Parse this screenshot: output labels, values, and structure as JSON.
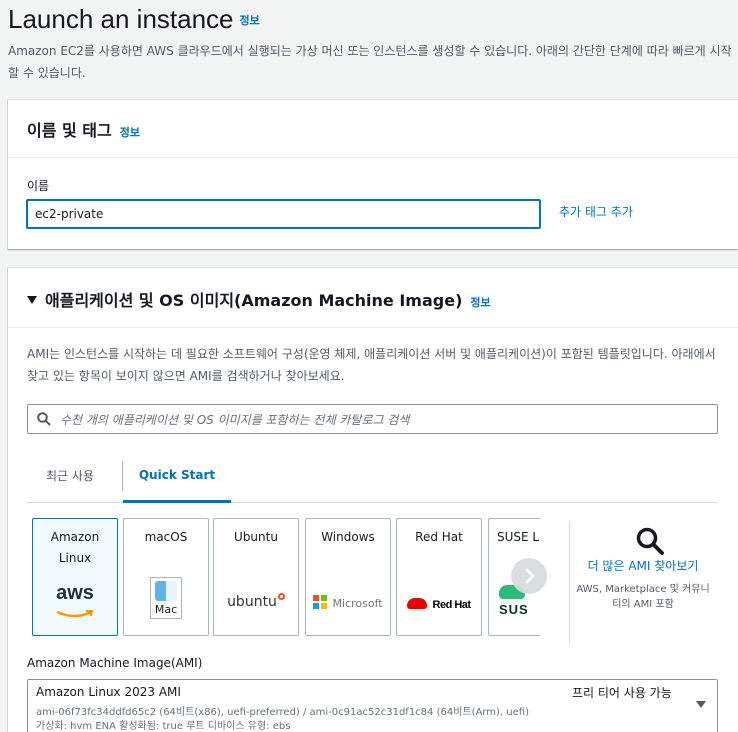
{
  "page": {
    "title": "Launch an instance",
    "info": "정보",
    "description": "Amazon EC2를 사용하면 AWS 클라우드에서 실행되는 가상 머신 또는 인스턴스를 생성할 수 있습니다. 아래의 간단한 단계에 따라 빠르게 시작할 수 있습니다."
  },
  "name_section": {
    "title": "이름 및 태그",
    "info": "정보",
    "name_label": "이름",
    "name_value": "ec2-private",
    "add_tag": "추가 태그 추가"
  },
  "ami_section": {
    "title": "애플리케이션 및 OS 이미지(Amazon Machine Image)",
    "info": "정보",
    "description": "AMI는 인스턴스를 시작하는 데 필요한 소프트웨어 구성(운영 체제, 애플리케이션 서버 및 애플리케이션)이 포함된 템플릿입니다. 아래에서 찾고 있는 항목이 보이지 않으면 AMI를 검색하거나 찾아보세요.",
    "search_placeholder": "수천 개의 애플리케이션 및 OS 이미지를 포함하는 전체 카탈로그 검색",
    "tabs": [
      "최근 사용",
      "Quick Start"
    ],
    "active_tab": "Quick Start",
    "cards": [
      {
        "label": "Amazon Linux",
        "logo": "aws",
        "selected": true
      },
      {
        "label": "macOS",
        "logo": "Mac"
      },
      {
        "label": "Ubuntu",
        "logo": "ubuntu"
      },
      {
        "label": "Windows",
        "logo": "Microsoft"
      },
      {
        "label": "Red Hat",
        "logo": "Red Hat"
      },
      {
        "label": "SUSE Li",
        "logo": "SUS"
      }
    ],
    "more_link": "더 많은 AMI 찾아보기",
    "more_sub": "AWS, Marketplace 및 커뮤니티의 AMI 포함",
    "ami_label": "Amazon Machine Image(AMI)",
    "ami_name": "Amazon Linux 2023 AMI",
    "ami_id": "ami-06f73fc34ddfd65c2 (64비트(x86), uefi-preferred) / ami-0c91ac52c31df1c84 (64비트(Arm), uefi)",
    "ami_attrs": "가상화: hvm    ENA 활성화됨: true    루트 디바이스 유형: ebs",
    "free_tier": "프리 티어 사용 가능"
  },
  "colors": {
    "link": "#0073bb",
    "aws_orange": "#ff9900",
    "ubuntu_orange": "#e95420",
    "redhat_red": "#ee0000",
    "suse_green": "#30ba78"
  }
}
